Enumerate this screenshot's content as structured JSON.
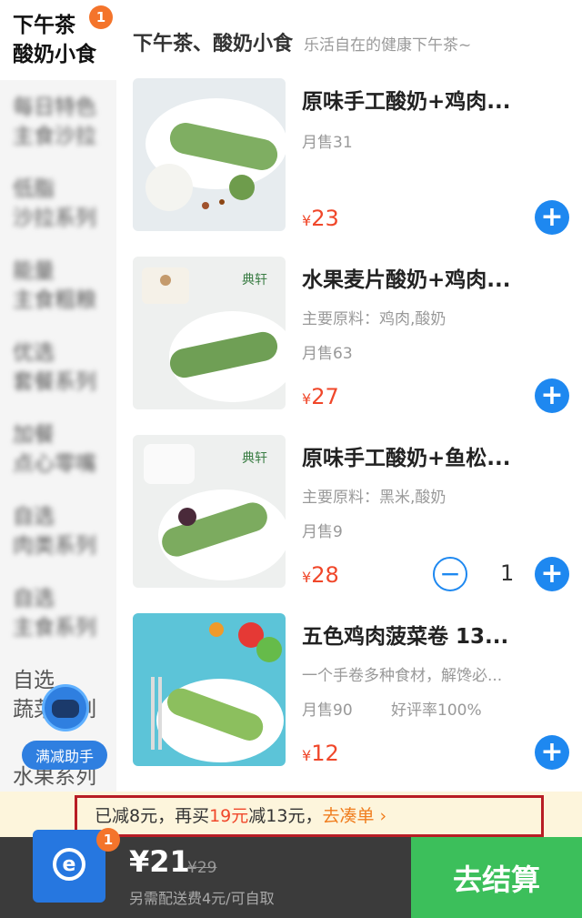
{
  "sidebar": {
    "badge": "1",
    "items": [
      {
        "lines": [
          "下午茶",
          "酸奶小食"
        ]
      },
      {
        "lines": [
          "每日特色",
          "主食沙拉"
        ]
      },
      {
        "lines": [
          "低脂",
          "沙拉系列"
        ]
      },
      {
        "lines": [
          "能量",
          "主食粗粮"
        ]
      },
      {
        "lines": [
          "优选",
          "套餐系列"
        ]
      },
      {
        "lines": [
          "加餐",
          "点心零嘴"
        ]
      },
      {
        "lines": [
          "自选",
          "肉类系列"
        ]
      },
      {
        "lines": [
          "自选",
          "主食系列"
        ]
      },
      {
        "lines": [
          "自选",
          "蔬菜系列"
        ]
      },
      {
        "lines": [
          "",
          "水果系列"
        ]
      }
    ],
    "helper_label": "满减助手"
  },
  "section": {
    "title": "下午茶、酸奶小食",
    "subtitle": "乐活自在的健康下午茶~"
  },
  "products": [
    {
      "name": "原味手工酸奶+鸡肉...",
      "ingredients": "",
      "sales": "月售31",
      "rating": "",
      "price_symbol": "¥",
      "price": "23",
      "qty": ""
    },
    {
      "name": "水果麦片酸奶+鸡肉...",
      "ingredients": "主要原料：鸡肉,酸奶",
      "sales": "月售63",
      "rating": "",
      "price_symbol": "¥",
      "price": "27",
      "qty": ""
    },
    {
      "name": "原味手工酸奶+鱼松...",
      "ingredients": "主要原料：黑米,酸奶",
      "sales": "月售9",
      "rating": "",
      "price_symbol": "¥",
      "price": "28",
      "qty": "1"
    },
    {
      "name": "五色鸡肉菠菜卷 13...",
      "ingredients": "一个手卷多种食材，解馋必...",
      "sales": "月售90",
      "rating": "好评率100%",
      "price_symbol": "¥",
      "price": "12",
      "qty": ""
    }
  ],
  "promo": {
    "part1": "已减8元，再买",
    "amount": "19元",
    "part2": "减13元，",
    "link": "去凑单 ›"
  },
  "cart": {
    "badge": "1",
    "icon_letter": "e",
    "total": "¥21",
    "original": "¥29",
    "delivery_note": "另需配送费4元/可自取",
    "checkout_label": "去结算"
  },
  "colors": {
    "accent_blue": "#1e88f0",
    "price_red": "#f0472a",
    "checkout_green": "#3cbf5b",
    "badge_orange": "#f4742b"
  }
}
